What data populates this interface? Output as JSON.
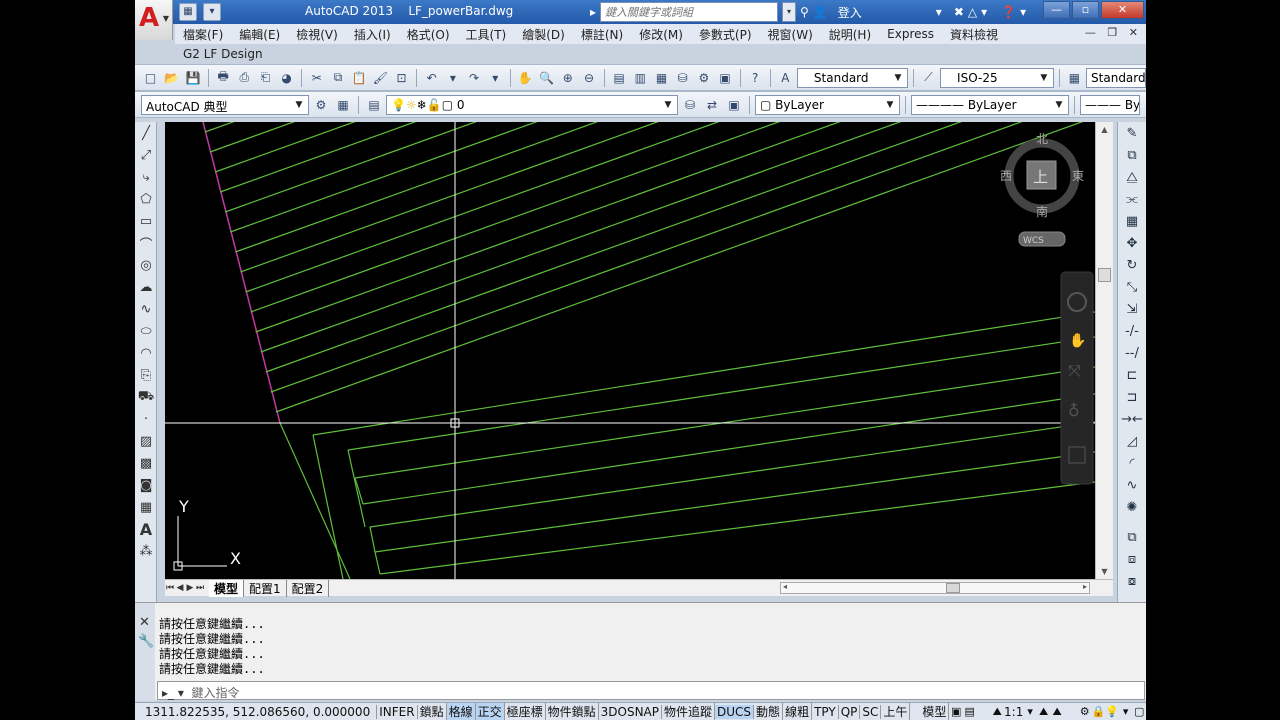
{
  "window": {
    "title_app": "AutoCAD 2013",
    "title_file": "LF_powerBar.dwg",
    "search_placeholder": "鍵入關鍵字或詞組",
    "login": "登入"
  },
  "menu": [
    "檔案(F)",
    "編輯(E)",
    "檢視(V)",
    "插入(I)",
    "格式(O)",
    "工具(T)",
    "繪製(D)",
    "標註(N)",
    "修改(M)",
    "參數式(P)",
    "視窗(W)",
    "說明(H)",
    "Express",
    "資料檢視"
  ],
  "subtitle": "G2 LF Design",
  "std_toolbar": {
    "text_style": "Standard",
    "dim_style": "ISO-25",
    "table_style": "Standard"
  },
  "prop_toolbar": {
    "workspace": "AutoCAD 典型",
    "layer": "0",
    "color": "ByLayer",
    "linetype": "ByLayer",
    "lineweight": "ByLayer"
  },
  "viewcube": {
    "north": "北",
    "south": "南",
    "east": "東",
    "west": "西",
    "top": "上",
    "wcs": "WCS"
  },
  "ucs": {
    "x": "X",
    "y": "Y"
  },
  "layout_tabs": [
    "模型",
    "配置1",
    "配置2"
  ],
  "command_history": [
    "請按任意鍵繼續...",
    "請按任意鍵繼續...",
    "請按任意鍵繼續...",
    "請按任意鍵繼續..."
  ],
  "command_prompt": "鍵入指令",
  "status": {
    "coordinates": "1311.822535, 512.086560, 0.000000",
    "buttons": [
      "INFER",
      "鎖點",
      "格線",
      "正交",
      "極座標",
      "物件鎖點",
      "3DOSNAP",
      "物件追蹤",
      "DUCS",
      "動態",
      "線粗",
      "TPY",
      "QP",
      "SC",
      "上午"
    ],
    "active_buttons": [
      "格線",
      "正交",
      "DUCS"
    ],
    "model_label": "模型",
    "annotation_scale": "1:1"
  },
  "colors": {
    "line_green": "#5fbf3a",
    "magenta": "#c03aa0",
    "crosshair": "#ffffff"
  }
}
